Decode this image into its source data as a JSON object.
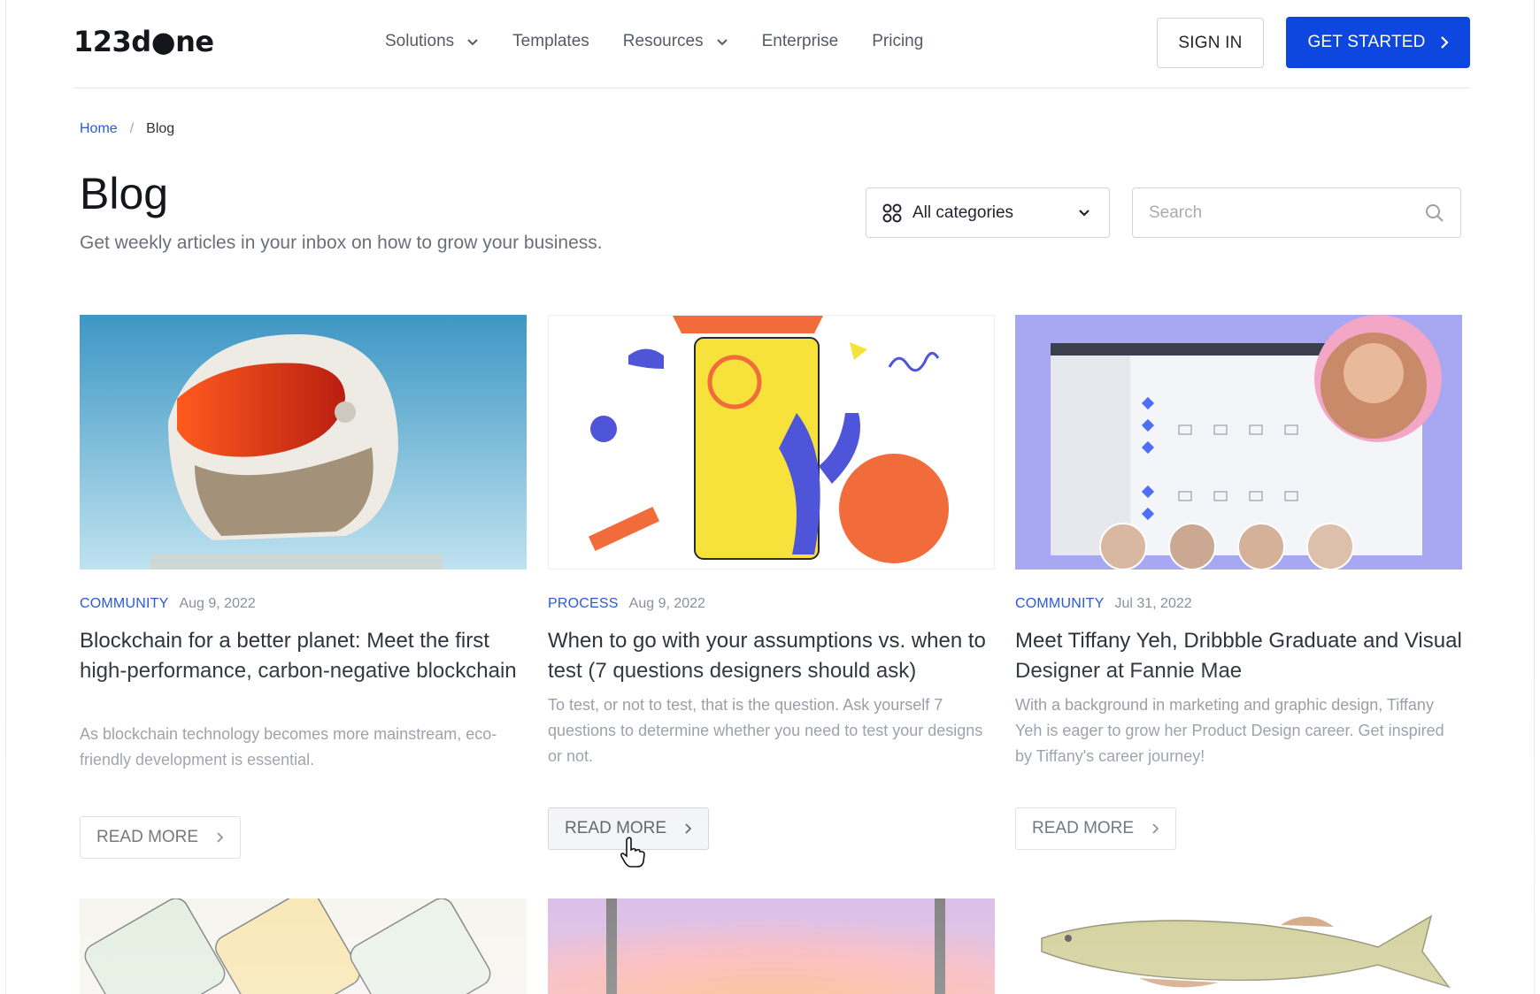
{
  "brand": {
    "logo_text": "123d●ne",
    "accent": "#0d47e0"
  },
  "nav": {
    "items": [
      {
        "label": "Solutions",
        "dropdown": true
      },
      {
        "label": "Templates",
        "dropdown": false
      },
      {
        "label": "Resources",
        "dropdown": true
      },
      {
        "label": "Enterprise",
        "dropdown": false
      },
      {
        "label": "Pricing",
        "dropdown": false
      }
    ],
    "sign_in": "SIGN IN",
    "get_started": "GET STARTED"
  },
  "breadcrumb": {
    "home": "Home",
    "sep": "/",
    "current": "Blog"
  },
  "page": {
    "title": "Blog",
    "subtitle": "Get weekly articles in your inbox on how to grow your business."
  },
  "filters": {
    "category_selected": "All categories",
    "search_placeholder": "Search"
  },
  "posts": [
    {
      "category": "COMMUNITY",
      "date": "Aug 9, 2022",
      "title": "Blockchain for a better planet: Meet the first high-performance, carbon-negative blockchain",
      "excerpt": "As blockchain technology becomes more mainstream, eco-friendly development is essential.",
      "cta": "READ MORE"
    },
    {
      "category": "PROCESS",
      "date": "Aug 9, 2022",
      "title": "When to go with your assumptions vs. when to test (7 questions designers should ask)",
      "excerpt": "To test, or not to test, that is the question. Ask yourself 7 questions to determine whether you need to test your designs or not.",
      "cta": "READ MORE"
    },
    {
      "category": "COMMUNITY",
      "date": "Jul 31, 2022",
      "title": "Meet Tiffany Yeh, Dribbble Graduate and Visual Designer at Fannie Mae",
      "excerpt": "With a background in marketing and graphic design, Tiffany Yeh is eager to grow her Product Design career. Get inspired by Tiffany's career journey!",
      "cta": "READ MORE"
    }
  ]
}
